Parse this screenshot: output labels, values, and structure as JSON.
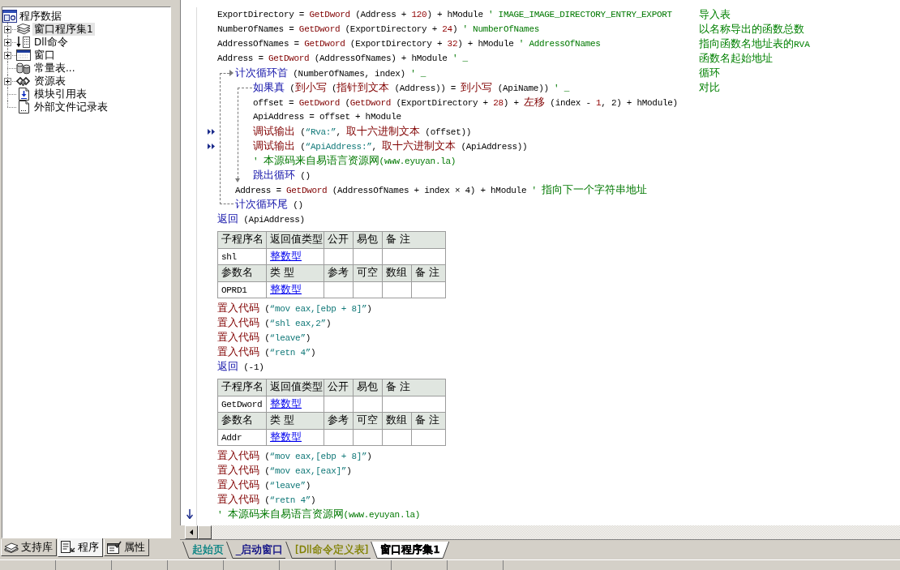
{
  "sidebar": {
    "tree": {
      "label": "程序数据",
      "selected": false,
      "children": [
        {
          "label": "窗口程序集1",
          "kind": "assembly",
          "collapsed": true,
          "selected": true
        },
        {
          "label": "Dll命令",
          "kind": "dll",
          "collapsed": true,
          "selected": false
        },
        {
          "label": "窗口",
          "kind": "window",
          "collapsed": true,
          "selected": false
        },
        {
          "label": "常量表...",
          "kind": "constants",
          "collapsed": false,
          "selected": false
        },
        {
          "label": "资源表",
          "kind": "resources",
          "collapsed": true,
          "selected": false
        },
        {
          "label": "模块引用表",
          "kind": "modules",
          "collapsed": false,
          "selected": false
        },
        {
          "label": "外部文件记录表",
          "kind": "files",
          "collapsed": false,
          "selected": false
        }
      ]
    },
    "tabs": [
      {
        "label": "支持库",
        "kind": "library",
        "selected": false
      },
      {
        "label": "程序",
        "kind": "program",
        "selected": true
      },
      {
        "label": "属性",
        "kind": "properties",
        "selected": false
      }
    ]
  },
  "editor": {
    "code": [
      {
        "kind": "line",
        "segments": [
          {
            "kind": "plain",
            "text": "ExportDirectory = "
          },
          {
            "kind": "func",
            "text": "GetDword"
          },
          {
            "kind": "plain",
            "text": " (Address + "
          },
          {
            "kind": "number",
            "text": "120"
          },
          {
            "kind": "plain",
            "text": ") + hModule "
          },
          {
            "kind": "comment",
            "text": "' IMAGE_IMAGE_DIRECTORY_ENTRY_EXPORT"
          }
        ],
        "note": "导入表"
      },
      {
        "kind": "line",
        "segments": [
          {
            "kind": "plain",
            "text": "NumberOfNames = "
          },
          {
            "kind": "func",
            "text": "GetDword"
          },
          {
            "kind": "plain",
            "text": " (ExportDirectory + "
          },
          {
            "kind": "number",
            "text": "24"
          },
          {
            "kind": "plain",
            "text": ") "
          },
          {
            "kind": "comment",
            "text": "' NumberOfNames"
          }
        ],
        "note": "以名称导出的函数总数"
      },
      {
        "kind": "line",
        "segments": [
          {
            "kind": "plain",
            "text": "AddressOfNames = "
          },
          {
            "kind": "func",
            "text": "GetDword"
          },
          {
            "kind": "plain",
            "text": " (ExportDirectory + "
          },
          {
            "kind": "number",
            "text": "32"
          },
          {
            "kind": "plain",
            "text": ") + hModule "
          },
          {
            "kind": "comment",
            "text": "' AddressOfNames"
          }
        ],
        "note": "指向函数名地址表的RVA"
      },
      {
        "kind": "line",
        "segments": [
          {
            "kind": "plain",
            "text": "Address = "
          },
          {
            "kind": "func",
            "text": "GetDword"
          },
          {
            "kind": "plain",
            "text": " (AddressOfNames) + hModule "
          },
          {
            "kind": "comment",
            "text": "' _"
          }
        ],
        "note": "函数名起始地址"
      },
      {
        "kind": "loop",
        "segments": [
          {
            "kind": "keyword",
            "text": "计次循环首"
          },
          {
            "kind": "plain",
            "text": " (NumberOfNames, index) "
          },
          {
            "kind": "comment",
            "text": "' _"
          }
        ],
        "note": "循环",
        "children": [
          {
            "kind": "if",
            "segments": [
              {
                "kind": "keyword",
                "text": "如果真"
              },
              {
                "kind": "plain",
                "text": " ("
              },
              {
                "kind": "func",
                "text": "到小写"
              },
              {
                "kind": "plain",
                "text": " ("
              },
              {
                "kind": "func",
                "text": "指针到文本"
              },
              {
                "kind": "plain",
                "text": " (Address)) = "
              },
              {
                "kind": "func",
                "text": "到小写"
              },
              {
                "kind": "plain",
                "text": " (ApiName)) "
              },
              {
                "kind": "comment",
                "text": "' _"
              }
            ],
            "note": "对比",
            "children": [
              {
                "kind": "line",
                "segments": [
                  {
                    "kind": "plain",
                    "text": "offset = "
                  },
                  {
                    "kind": "func",
                    "text": "GetDword"
                  },
                  {
                    "kind": "plain",
                    "text": " ("
                  },
                  {
                    "kind": "func",
                    "text": "GetDword"
                  },
                  {
                    "kind": "plain",
                    "text": " (ExportDirectory + "
                  },
                  {
                    "kind": "number",
                    "text": "28"
                  },
                  {
                    "kind": "plain",
                    "text": ") + "
                  },
                  {
                    "kind": "func",
                    "text": "左移"
                  },
                  {
                    "kind": "plain",
                    "text": " (index - "
                  },
                  {
                    "kind": "number",
                    "text": "1"
                  },
                  {
                    "kind": "plain",
                    "text": ", 2) + hModule)"
                  }
                ]
              },
              {
                "kind": "line",
                "segments": [
                  {
                    "kind": "plain",
                    "text": "ApiAddress = offset + hModule"
                  }
                ]
              },
              {
                "kind": "line",
                "debug_mark": true,
                "segments": [
                  {
                    "kind": "func",
                    "text": "调试输出"
                  },
                  {
                    "kind": "plain",
                    "text": " ("
                  },
                  {
                    "kind": "string",
                    "text": "“Rva:”"
                  },
                  {
                    "kind": "plain",
                    "text": ", "
                  },
                  {
                    "kind": "func",
                    "text": "取十六进制文本"
                  },
                  {
                    "kind": "plain",
                    "text": " (offset))"
                  }
                ]
              },
              {
                "kind": "line",
                "debug_mark": true,
                "segments": [
                  {
                    "kind": "func",
                    "text": "调试输出"
                  },
                  {
                    "kind": "plain",
                    "text": " ("
                  },
                  {
                    "kind": "string",
                    "text": "“ApiAddress:”"
                  },
                  {
                    "kind": "plain",
                    "text": ", "
                  },
                  {
                    "kind": "func",
                    "text": "取十六进制文本"
                  },
                  {
                    "kind": "plain",
                    "text": " (ApiAddress))"
                  }
                ]
              },
              {
                "kind": "line",
                "segments": [
                  {
                    "kind": "comment",
                    "text": "' 本源码来自易语言资源网(www.eyuyan.la)"
                  }
                ]
              },
              {
                "kind": "line",
                "segments": [
                  {
                    "kind": "keyword",
                    "text": "跳出循环"
                  },
                  {
                    "kind": "plain",
                    "text": " ()"
                  }
                ]
              }
            ]
          },
          {
            "kind": "line",
            "segments": [
              {
                "kind": "plain",
                "text": "Address = "
              },
              {
                "kind": "func",
                "text": "GetDword"
              },
              {
                "kind": "plain",
                "text": " (AddressOfNames + index × 4) + hModule "
              },
              {
                "kind": "comment",
                "text": "' 指向下一个字符串地址"
              }
            ]
          }
        ],
        "end": [
          {
            "kind": "keyword",
            "text": "计次循环尾"
          },
          {
            "kind": "plain",
            "text": " ()"
          }
        ]
      },
      {
        "kind": "line",
        "segments": [
          {
            "kind": "keyword",
            "text": "返回"
          },
          {
            "kind": "plain",
            "text": " (ApiAddress)"
          }
        ]
      },
      {
        "kind": "sub_table",
        "columns": [
          "子程序名",
          "返回值类型",
          "公开",
          "易包",
          "备 注"
        ],
        "row": [
          "shl",
          "整数型"
        ],
        "param_columns": [
          "参数名",
          "类 型",
          "参考",
          "可空",
          "数组",
          "备 注"
        ],
        "params": [
          [
            "OPRD1",
            "整数型"
          ]
        ]
      },
      {
        "kind": "line",
        "segments": [
          {
            "kind": "func",
            "text": "置入代码"
          },
          {
            "kind": "plain",
            "text": " ("
          },
          {
            "kind": "string",
            "text": "“mov eax,[ebp + 8]”"
          },
          {
            "kind": "plain",
            "text": ")"
          }
        ]
      },
      {
        "kind": "line",
        "segments": [
          {
            "kind": "func",
            "text": "置入代码"
          },
          {
            "kind": "plain",
            "text": " ("
          },
          {
            "kind": "string",
            "text": "“shl eax,2”"
          },
          {
            "kind": "plain",
            "text": ")"
          }
        ]
      },
      {
        "kind": "line",
        "segments": [
          {
            "kind": "func",
            "text": "置入代码"
          },
          {
            "kind": "plain",
            "text": " ("
          },
          {
            "kind": "string",
            "text": "“leave”"
          },
          {
            "kind": "plain",
            "text": ")"
          }
        ]
      },
      {
        "kind": "line",
        "segments": [
          {
            "kind": "func",
            "text": "置入代码"
          },
          {
            "kind": "plain",
            "text": " ("
          },
          {
            "kind": "string",
            "text": "“retn 4”"
          },
          {
            "kind": "plain",
            "text": ")"
          }
        ]
      },
      {
        "kind": "line",
        "segments": [
          {
            "kind": "keyword",
            "text": "返回"
          },
          {
            "kind": "plain",
            "text": " (-1)"
          }
        ]
      },
      {
        "kind": "sub_table",
        "columns": [
          "子程序名",
          "返回值类型",
          "公开",
          "易包",
          "备 注"
        ],
        "row": [
          "GetDword",
          "整数型"
        ],
        "param_columns": [
          "参数名",
          "类 型",
          "参考",
          "可空",
          "数组",
          "备 注"
        ],
        "params": [
          [
            "Addr",
            "整数型"
          ]
        ]
      },
      {
        "kind": "line",
        "segments": [
          {
            "kind": "func",
            "text": "置入代码"
          },
          {
            "kind": "plain",
            "text": " ("
          },
          {
            "kind": "string",
            "text": "“mov eax,[ebp + 8]”"
          },
          {
            "kind": "plain",
            "text": ")"
          }
        ]
      },
      {
        "kind": "line",
        "segments": [
          {
            "kind": "func",
            "text": "置入代码"
          },
          {
            "kind": "plain",
            "text": " ("
          },
          {
            "kind": "string",
            "text": "“mov eax,[eax]”"
          },
          {
            "kind": "plain",
            "text": ")"
          }
        ]
      },
      {
        "kind": "line",
        "segments": [
          {
            "kind": "func",
            "text": "置入代码"
          },
          {
            "kind": "plain",
            "text": " ("
          },
          {
            "kind": "string",
            "text": "“leave”"
          },
          {
            "kind": "plain",
            "text": ")"
          }
        ]
      },
      {
        "kind": "line",
        "segments": [
          {
            "kind": "func",
            "text": "置入代码"
          },
          {
            "kind": "plain",
            "text": " ("
          },
          {
            "kind": "string",
            "text": "“retn 4”"
          },
          {
            "kind": "plain",
            "text": ")"
          }
        ]
      },
      {
        "kind": "line",
        "arrow_mark": true,
        "segments": [
          {
            "kind": "comment",
            "text": "' 本源码来自易语言资源网(www.eyuyan.la)"
          }
        ]
      }
    ],
    "tabs": [
      {
        "label": "起始页",
        "color": "#008080",
        "selected": false
      },
      {
        "label": "_启动窗口",
        "color": "#000080",
        "selected": false
      },
      {
        "label": "[Dll命令定义表]",
        "color": "#808000",
        "selected": false
      },
      {
        "label": "窗口程序集1",
        "color": "#000000",
        "selected": true
      }
    ]
  }
}
